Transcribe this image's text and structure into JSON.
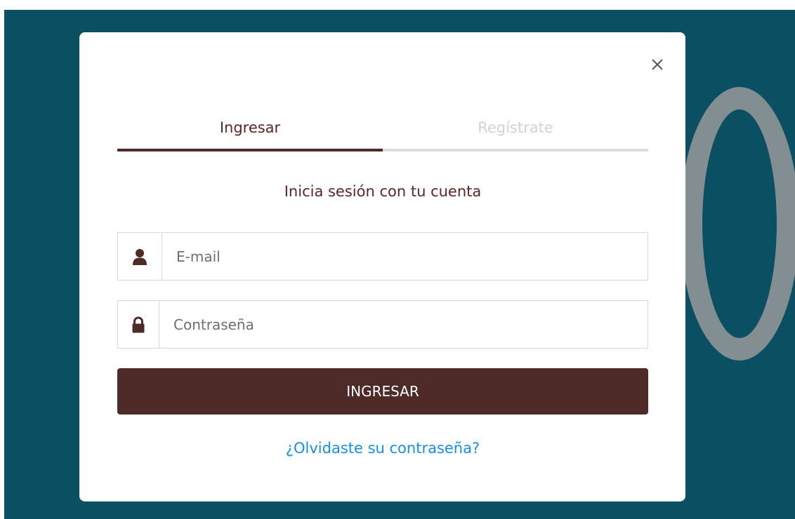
{
  "modal": {
    "tabs": [
      {
        "label": "Ingresar",
        "active": true
      },
      {
        "label": "Regístrate",
        "active": false
      }
    ],
    "subtitle": "Inicia sesión con tu cuenta",
    "email": {
      "placeholder": "E-mail",
      "value": "",
      "icon": "user-icon"
    },
    "password": {
      "placeholder": "Contraseña",
      "value": "",
      "icon": "lock-icon"
    },
    "submit_label": "INGRESAR",
    "forgot_label": "¿Olvidaste su contraseña?",
    "close_icon": "close-icon"
  },
  "colors": {
    "backdrop": "#0b5062",
    "primary": "#4e2b28",
    "tab_active_text": "#5a2626",
    "tab_inactive_text": "#d8d0d0",
    "link": "#1a8ee6"
  }
}
